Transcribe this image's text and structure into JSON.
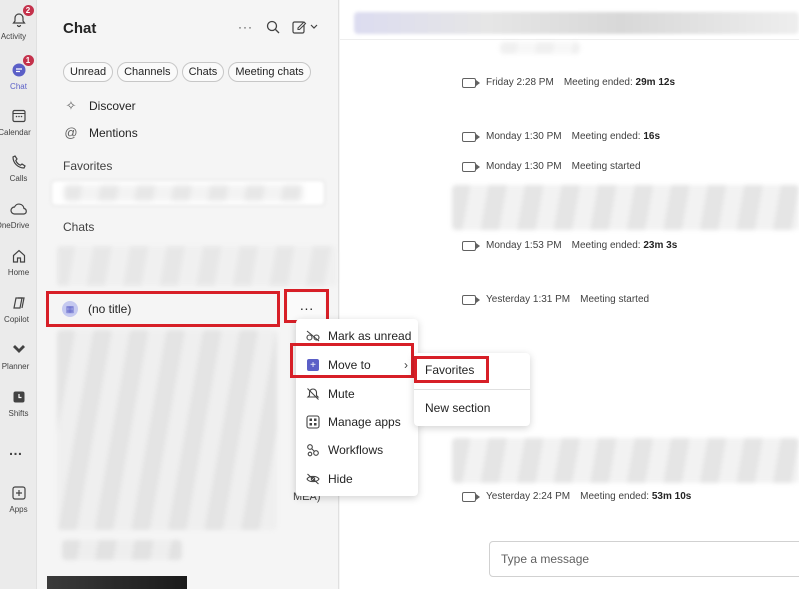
{
  "rail": {
    "items": [
      {
        "label": "Activity",
        "badge": "2"
      },
      {
        "label": "Chat",
        "badge": "1"
      },
      {
        "label": "Calendar"
      },
      {
        "label": "Calls"
      },
      {
        "label": "OneDrive"
      },
      {
        "label": "Home"
      },
      {
        "label": "Copilot"
      },
      {
        "label": "Planner"
      },
      {
        "label": "Shifts"
      },
      {
        "label": "…"
      },
      {
        "label": "Apps"
      }
    ]
  },
  "list": {
    "title": "Chat",
    "more": "···",
    "filters": [
      "Unread",
      "Channels",
      "Chats",
      "Meeting chats"
    ],
    "discover": "Discover",
    "mentions": "Mentions",
    "favorites_label": "Favorites",
    "chats_label": "Chats",
    "selected_chat": "(no title)",
    "row_more": "···",
    "mea": "MEA)"
  },
  "menu": {
    "items": [
      "Mark as unread",
      "Move to",
      "Mute",
      "Manage apps",
      "Workflows",
      "Hide"
    ]
  },
  "submenu": {
    "items": [
      "Favorites",
      "New section"
    ]
  },
  "conversation": {
    "events": [
      {
        "time": "Friday 2:28 PM",
        "text": "Meeting ended:",
        "duration": "29m 12s"
      },
      {
        "time": "Monday 1:30 PM",
        "text": "Meeting ended:",
        "duration": "16s"
      },
      {
        "time": "Monday 1:30 PM",
        "text": "Meeting started",
        "duration": ""
      },
      {
        "time": "Monday 1:53 PM",
        "text": "Meeting ended:",
        "duration": "23m 3s"
      },
      {
        "time": "Yesterday 1:31 PM",
        "text": "Meeting started",
        "duration": ""
      },
      {
        "time": "Yesterday 2:24 PM",
        "text": "Meeting ended:",
        "duration": "53m 10s"
      }
    ],
    "compose_placeholder": "Type a message"
  },
  "colors": {
    "accent": "#5b5fc7",
    "highlight": "#d71f27"
  }
}
